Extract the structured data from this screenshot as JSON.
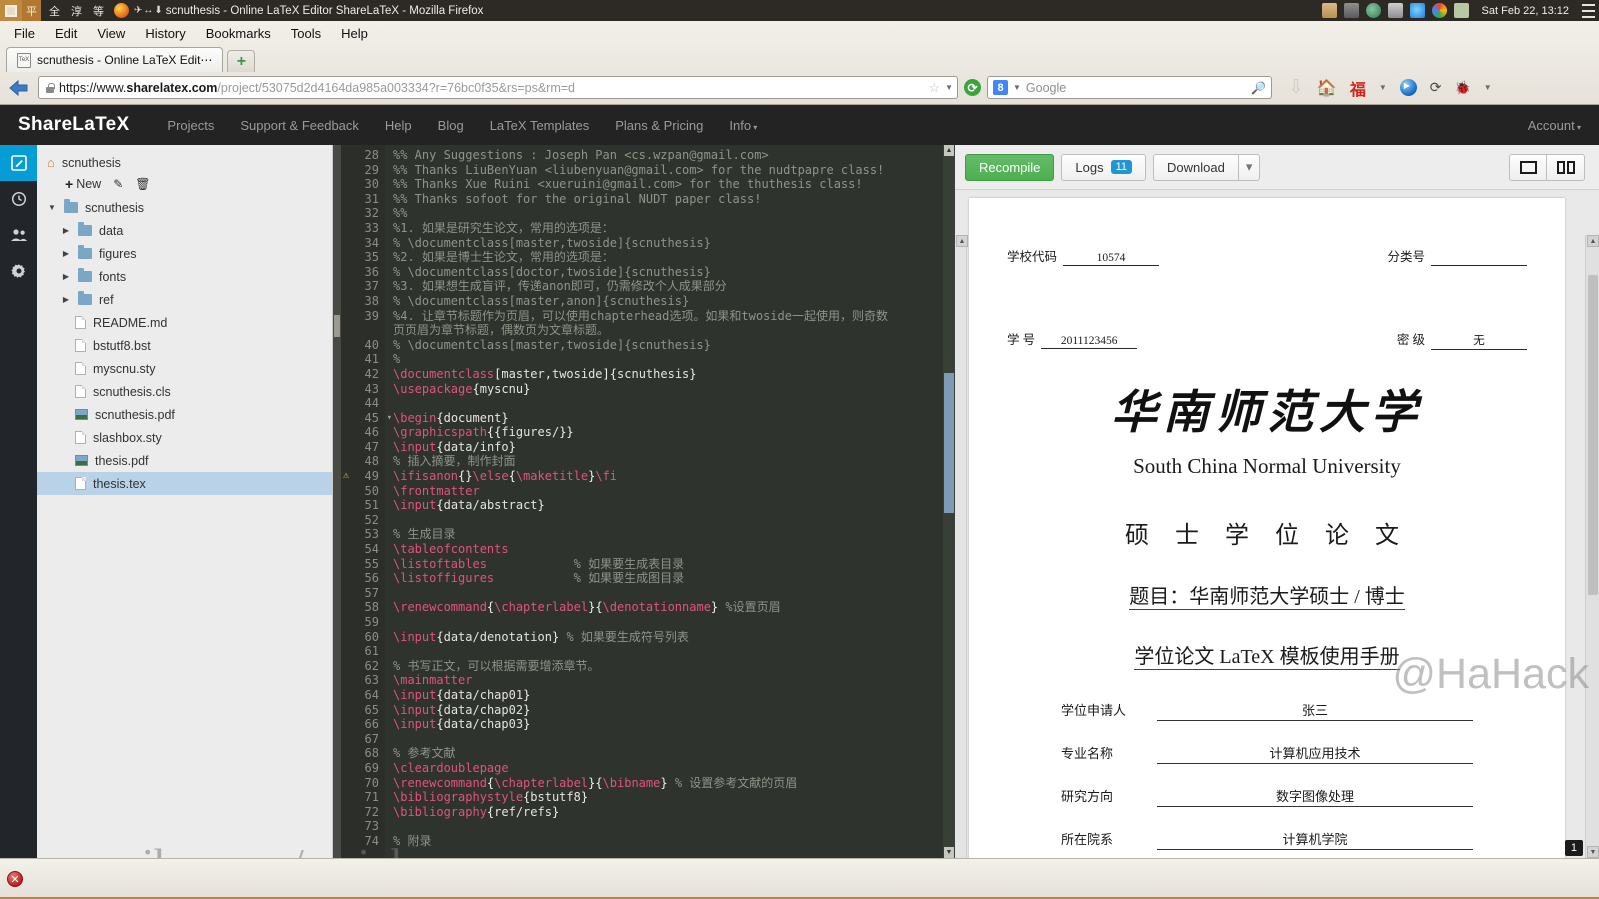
{
  "window": {
    "title": "scnuthesis - Online LaTeX Editor ShareLaTeX - Mozilla Firefox",
    "ime_items": [
      "平",
      "全",
      "淳",
      "等"
    ],
    "ime_glyphs": "✈↔⬇",
    "clock": "Sat Feb 22, 13:12"
  },
  "firefox": {
    "menus": [
      "File",
      "Edit",
      "View",
      "History",
      "Bookmarks",
      "Tools",
      "Help"
    ],
    "tab": {
      "label": "scnuthesis - Online LaTeX Edit⋯",
      "favicon": "tex-icon"
    },
    "newtab_label": "+",
    "url": {
      "scheme": "https://www.",
      "domain": "sharelatex.com",
      "path": "/project/53075d2d4164da985a003334?r=76bc0f35&rs=ps&rm=d"
    },
    "search": {
      "engine": "Google",
      "placeholder": "Google"
    }
  },
  "sharelatex": {
    "brand": "ShareLaTeX",
    "links": [
      "Projects",
      "Support & Feedback",
      "Help",
      "Blog",
      "LaTeX Templates",
      "Plans & Pricing",
      "Info"
    ],
    "account_label": "Account"
  },
  "rail": [
    {
      "name": "editor",
      "icon": "pencil-square-icon",
      "glyph": "✎",
      "active": true
    },
    {
      "name": "history",
      "icon": "clock-icon",
      "glyph": "◕",
      "active": false
    },
    {
      "name": "collaborators",
      "icon": "users-icon",
      "glyph": "👥",
      "active": false
    },
    {
      "name": "settings",
      "icon": "gear-icon",
      "glyph": "⚙",
      "active": false
    }
  ],
  "filetree": {
    "project_name": "scnuthesis",
    "new_label": "New",
    "nodes": [
      {
        "label": "scnuthesis",
        "type": "folder",
        "depth": 0,
        "open": true,
        "selected": false
      },
      {
        "label": "data",
        "type": "folder",
        "depth": 1,
        "open": false,
        "selected": false
      },
      {
        "label": "figures",
        "type": "folder",
        "depth": 1,
        "open": false,
        "selected": false
      },
      {
        "label": "fonts",
        "type": "folder",
        "depth": 1,
        "open": false,
        "selected": false
      },
      {
        "label": "ref",
        "type": "folder",
        "depth": 1,
        "open": false,
        "selected": false
      },
      {
        "label": "README.md",
        "type": "file",
        "depth": 2,
        "selected": false
      },
      {
        "label": "bstutf8.bst",
        "type": "file",
        "depth": 2,
        "selected": false
      },
      {
        "label": "myscnu.sty",
        "type": "file",
        "depth": 2,
        "selected": false
      },
      {
        "label": "scnuthesis.cls",
        "type": "file",
        "depth": 2,
        "selected": false
      },
      {
        "label": "scnuthesis.pdf",
        "type": "pdf",
        "depth": 2,
        "selected": false
      },
      {
        "label": "slashbox.sty",
        "type": "file",
        "depth": 2,
        "selected": false
      },
      {
        "label": "thesis.pdf",
        "type": "pdf",
        "depth": 2,
        "selected": false
      },
      {
        "label": "thesis.tex",
        "type": "file",
        "depth": 2,
        "selected": true
      }
    ]
  },
  "editor": {
    "first_line": 28,
    "warning_line": 49,
    "fold_line": 45,
    "lines": [
      "%% Any Suggestions : Joseph Pan <cs.wzpan@gmail.com>",
      "%% Thanks LiuBenYuan <liubenyuan@gmail.com> for the nudtpapre class!",
      "%% Thanks Xue Ruini <xueruini@gmail.com> for the thuthesis class!",
      "%% Thanks sofoot for the original NUDT paper class!",
      "%%",
      "%1. 如果是研究生论文，常用的选项是：",
      "% \\documentclass[master,twoside]{scnuthesis}",
      "%2. 如果是博士生论文，常用的选项是：",
      "% \\documentclass[doctor,twoside]{scnuthesis}",
      "%3. 如果想生成盲评，传递anon即可，仍需修改个人成果部分",
      "% \\documentclass[master,anon]{scnuthesis}",
      "%4. 让章节标题作为页眉，可以使用chapterhead选项。如果和twoside一起使用，则奇数",
      "页页眉为章节标题，偶数页为文章标题。",
      "% \\documentclass[master,twoside]{scnuthesis}",
      "%",
      "\\documentclass[master,twoside]{scnuthesis}",
      "\\usepackage{myscnu}",
      "",
      "\\begin{document}",
      "\\graphicspath{{figures/}}",
      "\\input{data/info}",
      "% 插入摘要，制作封面",
      "\\ifisanon{}\\else{\\maketitle}\\fi",
      "\\frontmatter",
      "\\input{data/abstract}",
      "",
      "% 生成目录",
      "\\tableofcontents",
      "\\listoftables            % 如果要生成表目录",
      "\\listoffigures           % 如果要生成图目录",
      "",
      "\\renewcommand{\\chapterlabel}{\\denotationname} %设置页眉",
      "",
      "\\input{data/denotation} % 如果要生成符号列表",
      "",
      "% 书写正文，可以根据需要增添章节。",
      "\\mainmatter",
      "\\input{data/chap01}",
      "\\input{data/chap02}",
      "\\input{data/chap03}",
      "",
      "% 参考文献",
      "\\cleardoublepage",
      "\\renewcommand{\\chapterlabel}{\\bibname} % 设置参考文献的页眉",
      "\\bibliographystyle{bstutf8}",
      "\\bibliography{ref/refs}",
      "",
      "% 附录"
    ]
  },
  "pdf_toolbar": {
    "recompile_label": "Recompile",
    "logs_label": "Logs",
    "logs_count": "11",
    "download_label": "Download",
    "download_caret": "▾",
    "layout_single_icon": "single-pane-icon",
    "layout_split_icon": "split-pane-icon"
  },
  "pdf_page": {
    "school_code_label": "学校代码",
    "school_code_value": "10574",
    "category_label": "分类号",
    "category_value": "",
    "student_no_label": "学  号",
    "student_no_value": "2011123456",
    "secrecy_label": "密  级",
    "secrecy_value": "无",
    "university_cn": "华南师范大学",
    "university_en": "South China Normal University",
    "degree_line": "硕 士 学 位 论 文",
    "title_line1": "题目：华南师范大学硕士 / 博士",
    "title_line2": "学位论文 LaTeX 模板使用手册",
    "rows": [
      {
        "key": "学位申请人",
        "value": "张三"
      },
      {
        "key": "专业名称",
        "value": "计算机应用技术"
      },
      {
        "key": "研究方向",
        "value": "数字图像处理"
      },
      {
        "key": "所在院系",
        "value": "计算机学院"
      }
    ],
    "page_badge": "1",
    "watermark_1": "@HaHack",
    "watermark_2": "weibo.com/weizhoupan"
  },
  "colors": {
    "accent_blue": "#069dd7",
    "recompile_green": "#4caf50",
    "badge_blue": "#2196d3",
    "editor_bg": "#2f332d",
    "nav_dark": "#232323"
  }
}
